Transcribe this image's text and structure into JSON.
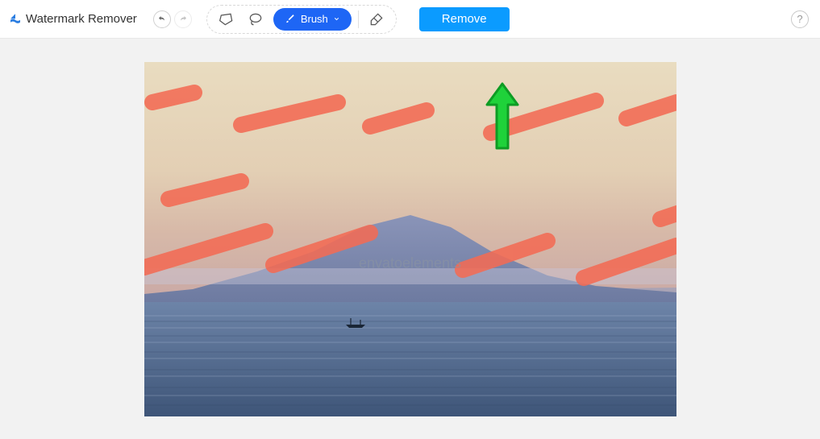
{
  "header": {
    "app_title": "Watermark Remover"
  },
  "toolbar": {
    "brush_label": "Brush",
    "remove_label": "Remove"
  },
  "canvas": {
    "watermark_text": "envatoelements"
  }
}
